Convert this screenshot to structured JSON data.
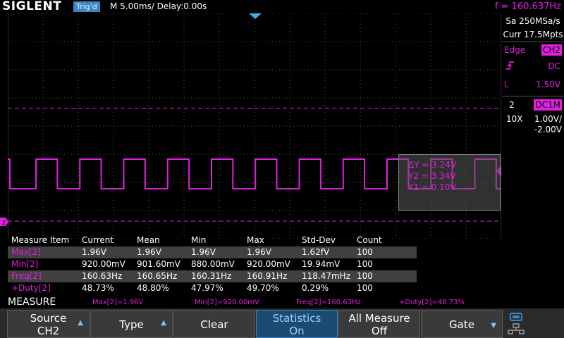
{
  "header": {
    "brand": "SIGLENT",
    "trigger_state": "Trig'd",
    "timebase": "M 5.00ms/ Delay:0.00s",
    "frequency": "f = 160.637Hz"
  },
  "acquisition": {
    "sample_rate": "Sa 250MSa/s",
    "memory_depth": "Curr 17.5Mpts"
  },
  "trigger": {
    "type": "Edge",
    "source": "CH2",
    "coupling": "DC",
    "level_label": "L",
    "level": "1.50V",
    "slope_icon": "rising-edge-icon"
  },
  "channel": {
    "number": "2",
    "coupling": "DC1M",
    "probe": "10X",
    "vdiv": "1.00V/",
    "offset": "-2.00V"
  },
  "cursors": {
    "delta_y": "ΔY = 3.24V",
    "y2": "Y2 = 3.34V",
    "y1": "Y1 = 0.10V"
  },
  "measure_table": {
    "headers": [
      "Measure Item",
      "Current",
      "Mean",
      "Min",
      "Max",
      "Std-Dev",
      "Count"
    ],
    "rows": [
      [
        "Max[2]",
        "1.96V",
        "1.96V",
        "1.96V",
        "1.96V",
        "1.62fV",
        "100"
      ],
      [
        "Min[2]",
        "920.00mV",
        "901.60mV",
        "880.00mV",
        "920.00mV",
        "19.94mV",
        "100"
      ],
      [
        "Freq[2]",
        "160.63Hz",
        "160.65Hz",
        "160.31Hz",
        "160.91Hz",
        "118.47mHz",
        "100"
      ],
      [
        "+Duty[2]",
        "48.73%",
        "48.80%",
        "47.97%",
        "49.70%",
        "0.29%",
        "100"
      ]
    ]
  },
  "measure_bar": {
    "title": "MEASURE",
    "items": [
      "Max[2]=1.96V",
      "Min[2]=920.00mV",
      "Freq[2]=160.63Hz",
      "+Duty[2]=48.73%"
    ]
  },
  "softkeys": [
    {
      "line1": "Source",
      "line2": "CH2",
      "arrow": true
    },
    {
      "line1": "Type",
      "line2": "",
      "arrow": true
    },
    {
      "line1": "Clear",
      "line2": "",
      "arrow": false
    },
    {
      "line1": "Statistics",
      "line2": "On",
      "arrow": false
    },
    {
      "line1": "All Measure",
      "line2": "Off",
      "arrow": false
    },
    {
      "line1": "Gate",
      "line2": "",
      "arrow": true
    }
  ],
  "colors": {
    "trace": "#e21fe2",
    "accent": "#3b86c6",
    "grid": "#5a5a5a"
  },
  "waveform": {
    "period_ms": 6.225,
    "duty_percent": 48.73
  }
}
